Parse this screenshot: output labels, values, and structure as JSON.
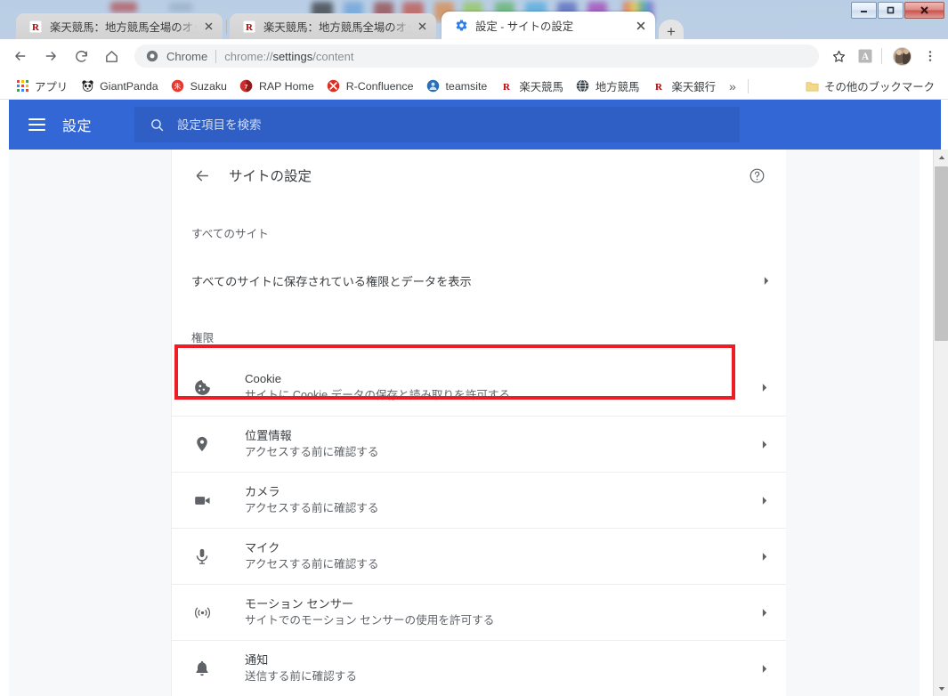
{
  "window": {
    "controls": {
      "minimize": "–",
      "maximize": "□",
      "close": "✕"
    }
  },
  "tabs": [
    {
      "title": "楽天競馬：地方競馬全場のオッ",
      "favicon": "rakuten-r-icon",
      "active": false,
      "close_label": "✕"
    },
    {
      "title": "楽天競馬：地方競馬全場のオッ",
      "favicon": "rakuten-r-icon",
      "active": false,
      "close_label": "✕"
    },
    {
      "title": "設定 - サイトの設定",
      "favicon": "settings-gear-icon",
      "active": true,
      "close_label": "✕"
    }
  ],
  "new_tab_label": "+",
  "toolbar": {
    "back_label": "←",
    "forward_label": "→",
    "reload_label": "⟳",
    "home_label": "⌂",
    "omnibox": {
      "scheme_label": "Chrome",
      "url_prefix": "chrome://",
      "url_bold": "settings",
      "url_suffix": "/content",
      "full_url": "chrome://settings/content"
    },
    "bookmark_star": "☆",
    "pdf_icon": "adobe-pdf-icon",
    "profile_icon": "profile-avatar",
    "menu_icon": "three-dot-menu-icon"
  },
  "bookmarks": {
    "items": [
      {
        "label": "アプリ",
        "icon": "apps-grid-icon"
      },
      {
        "label": "GiantPanda",
        "icon": "panda-icon"
      },
      {
        "label": "Suzaku",
        "icon": "suzaku-red-circle-icon"
      },
      {
        "label": "RAP Home",
        "icon": "rap-red-circle-icon"
      },
      {
        "label": "R-Confluence",
        "icon": "confluence-red-icon"
      },
      {
        "label": "teamsite",
        "icon": "teamsite-blue-icon"
      },
      {
        "label": "楽天競馬",
        "icon": "rakuten-r-icon"
      },
      {
        "label": "地方競馬",
        "icon": "globe-dark-icon"
      },
      {
        "label": "楽天銀行",
        "icon": "rakuten-r-icon"
      }
    ],
    "overflow_label": "»",
    "other_bookmarks": {
      "label": "その他のブックマーク",
      "icon": "folder-icon"
    }
  },
  "settings": {
    "hamburger": "menu-icon",
    "title": "設定",
    "search": {
      "placeholder": "設定項目を検索",
      "value": "",
      "icon": "search-icon"
    },
    "subpage": {
      "back_icon": "arrow-back-icon",
      "title": "サイトの設定",
      "help_icon": "help-circle-icon"
    },
    "sections": [
      {
        "label": "すべてのサイト",
        "rows": [
          {
            "title": "すべてのサイトに保存されている権限とデータを表示",
            "sub": "",
            "icon": "",
            "chevron": "›",
            "simple": true
          }
        ]
      },
      {
        "label": "権限",
        "rows": [
          {
            "title": "Cookie",
            "sub": "サイトに Cookie データの保存と読み取りを許可する",
            "icon": "cookie-icon",
            "chevron": "›",
            "highlighted": true
          },
          {
            "title": "位置情報",
            "sub": "アクセスする前に確認する",
            "icon": "location-pin-icon",
            "chevron": "›"
          },
          {
            "title": "カメラ",
            "sub": "アクセスする前に確認する",
            "icon": "camera-icon",
            "chevron": "›"
          },
          {
            "title": "マイク",
            "sub": "アクセスする前に確認する",
            "icon": "microphone-icon",
            "chevron": "›"
          },
          {
            "title": "モーション センサー",
            "sub": "サイトでのモーション センサーの使用を許可する",
            "icon": "motion-sensor-icon",
            "chevron": "›"
          },
          {
            "title": "通知",
            "sub": "送信する前に確認する",
            "icon": "bell-icon",
            "chevron": "›"
          }
        ]
      }
    ]
  },
  "scrollbar": {
    "up_label": "▲",
    "down_label": "▼"
  },
  "colors": {
    "settings_header_blue": "#3367d6",
    "search_box_blue": "#2f5fc4",
    "highlight_red": "#ee1c25",
    "text_primary": "#3c4043",
    "text_secondary": "#5f6368"
  }
}
